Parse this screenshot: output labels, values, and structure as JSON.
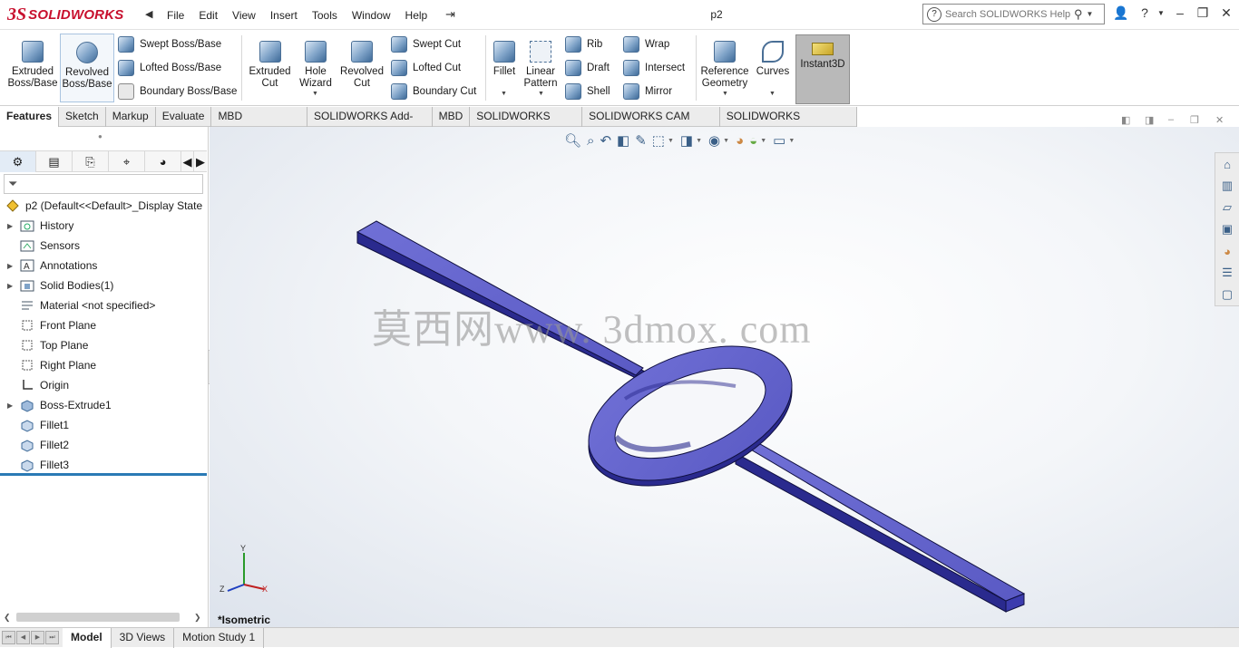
{
  "app": {
    "logo_ds": "3S",
    "logo_text": "SOLIDWORKS",
    "doc_title": "p2"
  },
  "menu": [
    "File",
    "Edit",
    "View",
    "Insert",
    "Tools",
    "Window",
    "Help"
  ],
  "search": {
    "placeholder": "Search SOLIDWORKS Help"
  },
  "ribbon": {
    "extruded_boss": "Extruded Boss/Base",
    "revolved_boss": "Revolved Boss/Base",
    "swept_boss": "Swept Boss/Base",
    "lofted_boss": "Lofted Boss/Base",
    "boundary_boss": "Boundary Boss/Base",
    "extruded_cut": "Extruded Cut",
    "hole_wizard": "Hole Wizard",
    "revolved_cut": "Revolved Cut",
    "swept_cut": "Swept Cut",
    "lofted_cut": "Lofted Cut",
    "boundary_cut": "Boundary Cut",
    "fillet": "Fillet",
    "linear_pattern": "Linear Pattern",
    "rib": "Rib",
    "draft": "Draft",
    "shell": "Shell",
    "wrap": "Wrap",
    "intersect": "Intersect",
    "mirror": "Mirror",
    "reference_geometry": "Reference Geometry",
    "curves": "Curves",
    "instant3d": "Instant3D"
  },
  "command_tabs": [
    "Features",
    "Sketch",
    "Markup",
    "Evaluate",
    "MBD Dimensions",
    "SOLIDWORKS Add-Ins",
    "MBD",
    "SOLIDWORKS CAM",
    "SOLIDWORKS CAM TBM",
    "SOLIDWORKS Inspection"
  ],
  "tree": {
    "root": "p2  (Default<<Default>_Display State",
    "items": [
      {
        "label": "History",
        "expandable": true
      },
      {
        "label": "Sensors",
        "expandable": false
      },
      {
        "label": "Annotations",
        "expandable": true
      },
      {
        "label": "Solid Bodies(1)",
        "expandable": true
      },
      {
        "label": "Material <not specified>",
        "expandable": false
      },
      {
        "label": "Front Plane",
        "expandable": false
      },
      {
        "label": "Top Plane",
        "expandable": false
      },
      {
        "label": "Right Plane",
        "expandable": false
      },
      {
        "label": "Origin",
        "expandable": false
      },
      {
        "label": "Boss-Extrude1",
        "expandable": true
      },
      {
        "label": "Fillet1",
        "expandable": false
      },
      {
        "label": "Fillet2",
        "expandable": false
      },
      {
        "label": "Fillet3",
        "expandable": false
      }
    ]
  },
  "viewport": {
    "watermark": "莫西网www. 3dmox. com",
    "view_label": "*Isometric",
    "triad": {
      "x": "X",
      "y": "Y",
      "z": "Z"
    },
    "model_color": "#6464cc"
  },
  "bottom_tabs": [
    "Model",
    "3D Views",
    "Motion Study 1"
  ]
}
